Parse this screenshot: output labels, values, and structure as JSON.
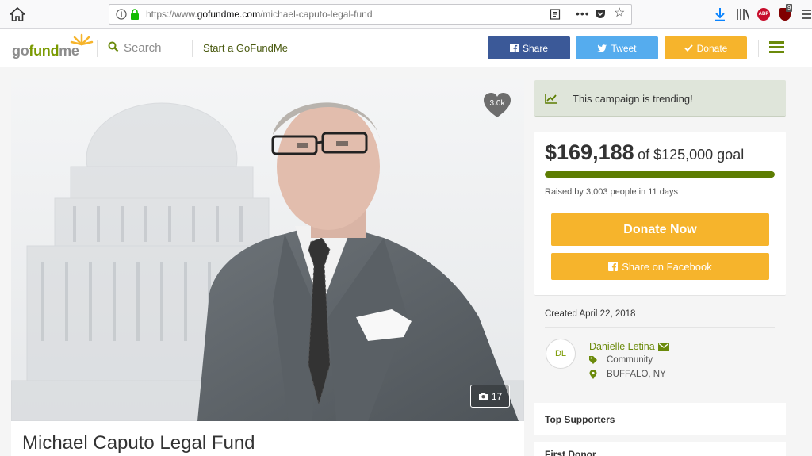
{
  "browser": {
    "url_scheme": "https://www.",
    "url_host": "gofundme.com",
    "url_path": "/michael-caputo-legal-fund",
    "ublock_badge": "9",
    "abp_label": "ABP"
  },
  "header": {
    "logo_go": "go",
    "logo_fund": "fund",
    "logo_me": "me",
    "search_label": "Search",
    "start_label": "Start a GoFundMe",
    "share_label": "Share",
    "tweet_label": "Tweet",
    "donate_label": "Donate",
    "colors": {
      "facebook": "#3b5998",
      "twitter": "#55acee",
      "donate": "#f6b42c",
      "brand_green": "#6b8a0b"
    }
  },
  "hero": {
    "heart_count": "3.0k",
    "photo_count": "17",
    "title": "Michael Caputo Legal Fund"
  },
  "sidebar": {
    "trending_text": "This campaign is trending!",
    "raised_amount": "$169,188",
    "goal_text": "of $125,000 goal",
    "progress_fraction": 1.0,
    "raised_by": "Raised by 3,003 people in 11 days",
    "donate_now_label": "Donate Now",
    "share_fb_label": "Share on Facebook",
    "created": "Created April 22, 2018",
    "organizer": {
      "initials": "DL",
      "name": "Danielle Letina",
      "category": "Community",
      "location": "BUFFALO, NY"
    },
    "top_supporters_label": "Top Supporters",
    "first_donor_label": "First Donor"
  }
}
